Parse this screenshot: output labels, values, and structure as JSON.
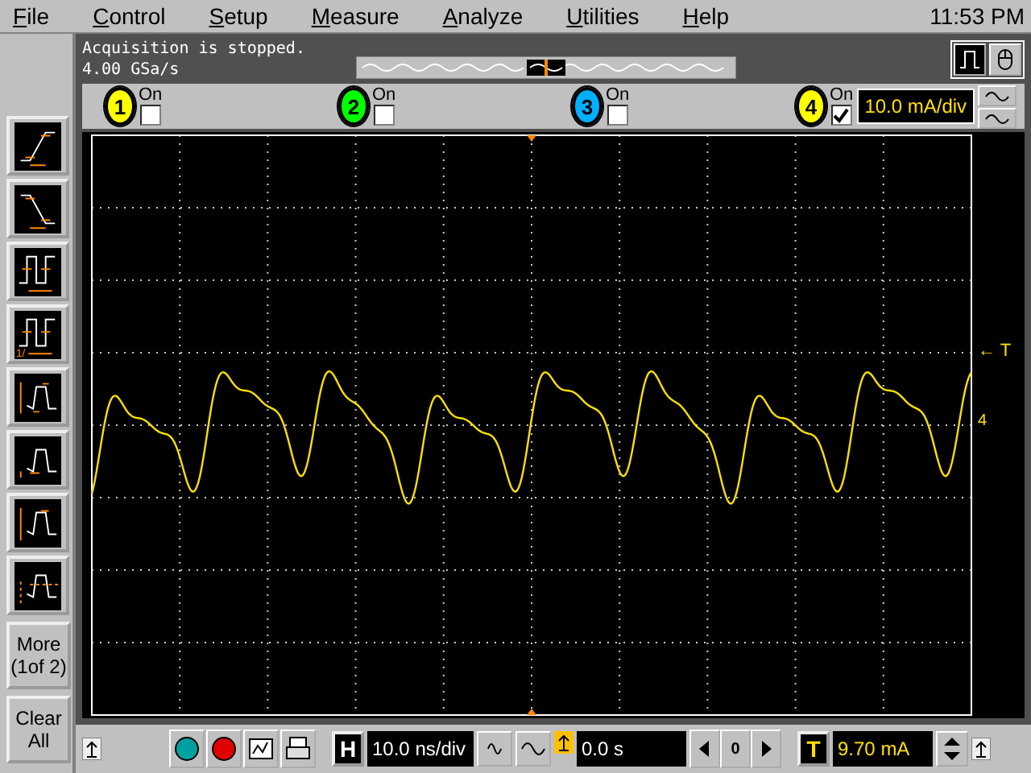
{
  "menu": [
    {
      "label": "File"
    },
    {
      "label": "Control"
    },
    {
      "label": "Setup"
    },
    {
      "label": "Measure"
    },
    {
      "label": "Analyze"
    },
    {
      "label": "Utilities"
    },
    {
      "label": "Help"
    }
  ],
  "clock": "11:53 PM",
  "status": {
    "line_1": "Acquisition is stopped.",
    "line_2": "4.00 GSa/s"
  },
  "channels": [
    {
      "number": "1",
      "color": "#ffff00",
      "on_label": "On",
      "checked": false
    },
    {
      "number": "2",
      "color": "#00ff00",
      "on_label": "On",
      "checked": false
    },
    {
      "number": "3",
      "color": "#00b0ff",
      "on_label": "On",
      "checked": false
    },
    {
      "number": "4",
      "color": "#ffff00",
      "on_label": "On",
      "checked": true,
      "scale": "10.0 mA/div"
    }
  ],
  "measurements": [
    {
      "kind": "rise"
    },
    {
      "kind": "fall"
    },
    {
      "kind": "period"
    },
    {
      "kind": "frequency",
      "label": "1/"
    },
    {
      "kind": "vpp"
    },
    {
      "kind": "vmin"
    },
    {
      "kind": "vmax"
    },
    {
      "kind": "vavg"
    }
  ],
  "side_buttons": [
    "More\n(1of 2)",
    "Clear\nAll"
  ],
  "trigger_marker": "← T",
  "ground_marker": "4",
  "bottom": {
    "horizontal_label": "H",
    "timebase": "10.0 ns/div",
    "delay": "0.0 s",
    "zero_button": "0",
    "trigger_label": "T",
    "trigger_level": "9.70 mA"
  }
}
